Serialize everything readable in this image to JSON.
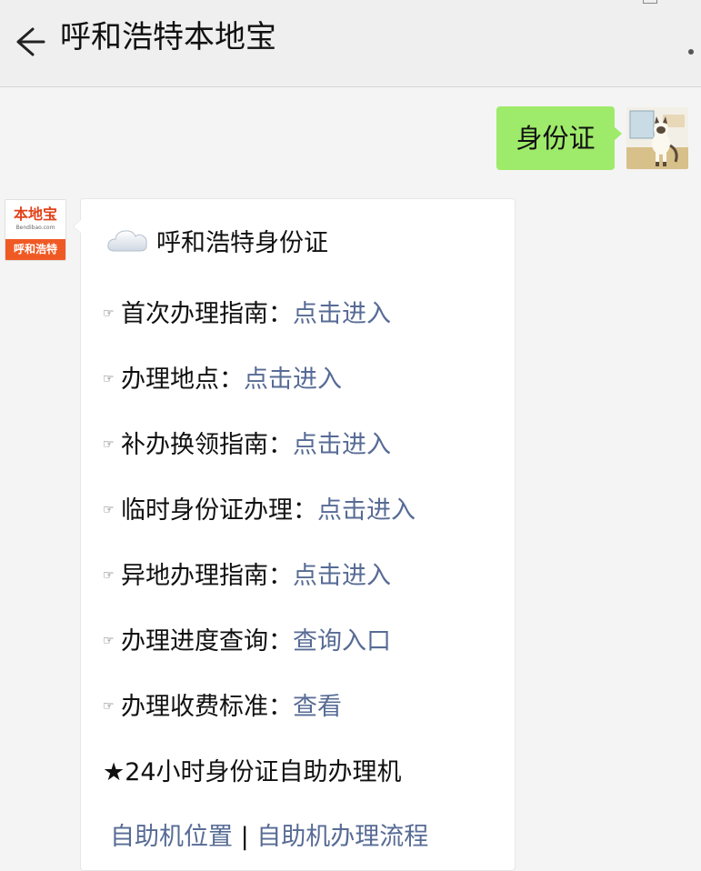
{
  "header": {
    "title": "呼和浩特本地宝",
    "back_icon": "arrow-left-icon",
    "more_icon": "more-dot-icon"
  },
  "user_message": {
    "text": "身份证",
    "bubble_color": "#9eea6a"
  },
  "bot": {
    "logo": {
      "name": "本地宝",
      "domain": "Bendibao.com",
      "city": "呼和浩特",
      "brand_color": "#ef5a24"
    },
    "message": {
      "title": "呼和浩特身份证",
      "title_icon": "cloud-icon",
      "hand_glyph": "☞",
      "items": [
        {
          "label": "首次办理指南：",
          "link": "点击进入"
        },
        {
          "label": "办理地点：",
          "link": "点击进入"
        },
        {
          "label": "补办换领指南：",
          "link": "点击进入"
        },
        {
          "label": "临时身份证办理：",
          "link": "点击进入"
        },
        {
          "label": "异地办理指南：",
          "link": "点击进入"
        },
        {
          "label": "办理进度查询：",
          "link": "查询入口"
        },
        {
          "label": "办理收费标准：",
          "link": "查看"
        }
      ],
      "kiosk_heading": "★24小时身份证自助办理机",
      "kiosk_links": [
        "自助机位置",
        "自助机办理流程"
      ],
      "kiosk_separator": "|",
      "link_color": "#576b95"
    }
  }
}
